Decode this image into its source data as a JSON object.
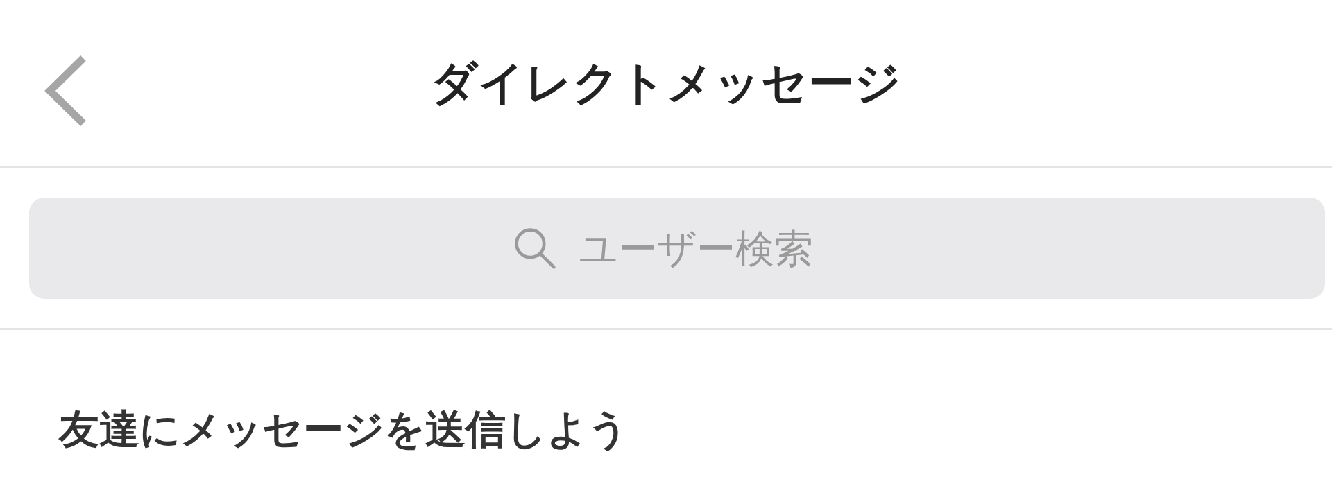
{
  "header": {
    "title": "ダイレクトメッセージ"
  },
  "search": {
    "placeholder": "ユーザー検索"
  },
  "prompt": "友達にメッセージを送信しよう"
}
